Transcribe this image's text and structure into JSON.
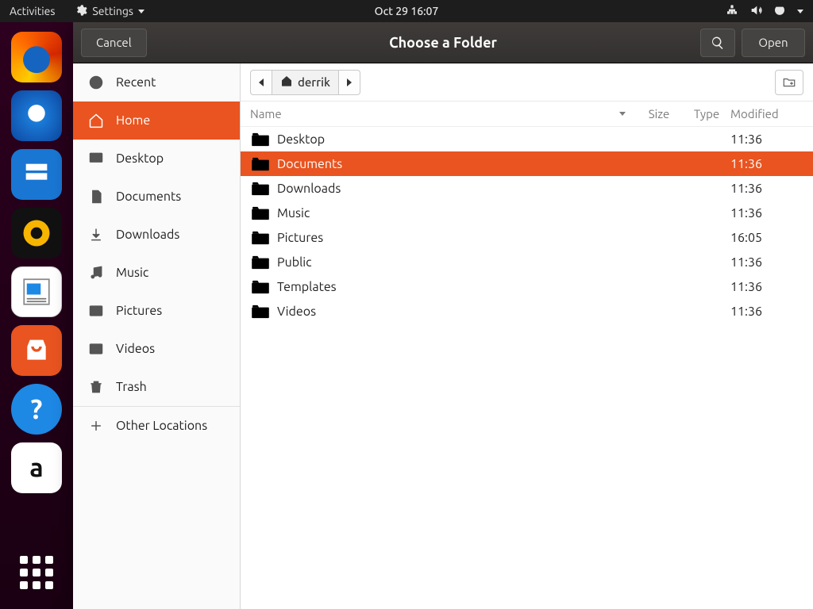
{
  "top_panel": {
    "activities": "Activities",
    "app_menu": "Settings",
    "clock": "Oct 29  16:07"
  },
  "dialog": {
    "cancel": "Cancel",
    "title": "Choose a Folder",
    "open": "Open"
  },
  "sidebar": {
    "items": [
      {
        "label": "Recent",
        "icon": "clock"
      },
      {
        "label": "Home",
        "icon": "home",
        "selected": true
      },
      {
        "label": "Desktop",
        "icon": "desktop"
      },
      {
        "label": "Documents",
        "icon": "documents"
      },
      {
        "label": "Downloads",
        "icon": "downloads"
      },
      {
        "label": "Music",
        "icon": "music"
      },
      {
        "label": "Pictures",
        "icon": "pictures"
      },
      {
        "label": "Videos",
        "icon": "videos"
      },
      {
        "label": "Trash",
        "icon": "trash"
      }
    ],
    "other_locations": "Other Locations"
  },
  "path": {
    "home_label": "derrik"
  },
  "columns": {
    "name": "Name",
    "size": "Size",
    "type": "Type",
    "modified": "Modified"
  },
  "files": [
    {
      "name": "Desktop",
      "modified": "11:36",
      "icon": "folder-desktop"
    },
    {
      "name": "Documents",
      "modified": "11:36",
      "icon": "folder",
      "selected": true
    },
    {
      "name": "Downloads",
      "modified": "11:36",
      "icon": "folder"
    },
    {
      "name": "Music",
      "modified": "11:36",
      "icon": "folder"
    },
    {
      "name": "Pictures",
      "modified": "16:05",
      "icon": "folder"
    },
    {
      "name": "Public",
      "modified": "11:36",
      "icon": "folder"
    },
    {
      "name": "Templates",
      "modified": "11:36",
      "icon": "folder"
    },
    {
      "name": "Videos",
      "modified": "11:36",
      "icon": "folder"
    }
  ]
}
